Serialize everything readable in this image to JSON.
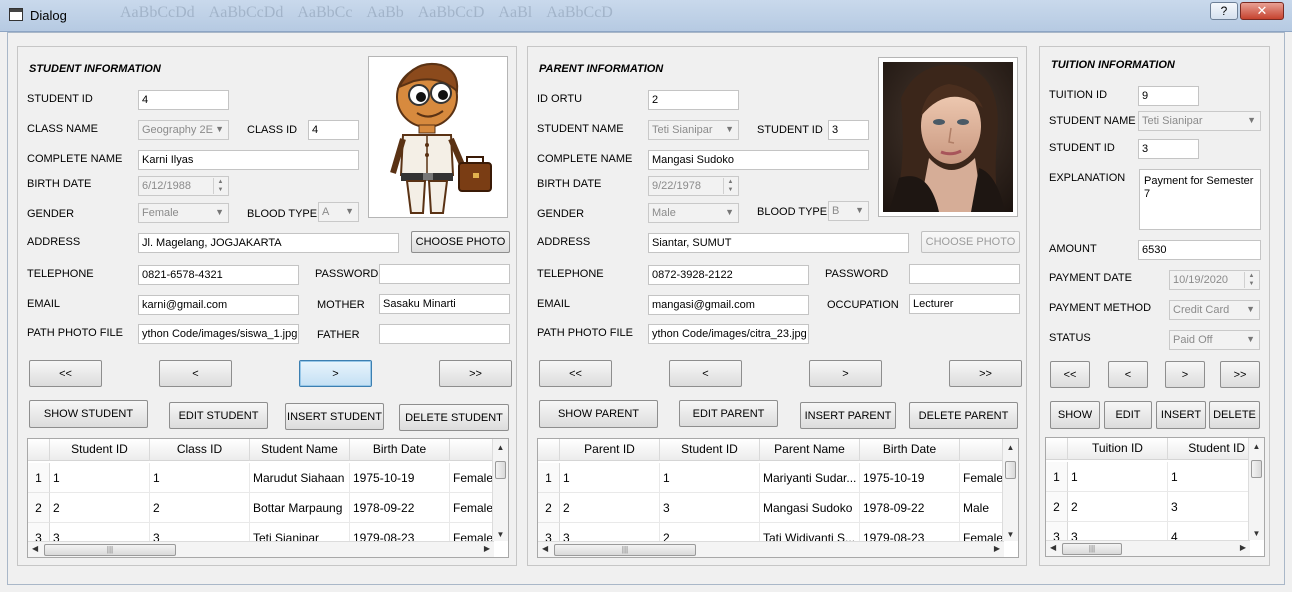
{
  "window": {
    "title": "Dialog",
    "help_glyph": "?",
    "close_glyph": "✕",
    "ribbon_ghost": [
      "AaBbCcDd",
      "AaBbCcDd",
      "AaBbCc",
      "AaBb",
      "AaBbCcD",
      "AaBl",
      "AaBbCcD"
    ]
  },
  "student": {
    "title": "STUDENT INFORMATION",
    "labels": {
      "student_id": "STUDENT ID",
      "class_name": "CLASS NAME",
      "class_id": "CLASS ID",
      "complete_name": "COMPLETE NAME",
      "birth_date": "BIRTH DATE",
      "gender": "GENDER",
      "blood_type": "BLOOD TYPE",
      "address": "ADDRESS",
      "telephone": "TELEPHONE",
      "password": "PASSWORD",
      "email": "EMAIL",
      "mother": "MOTHER",
      "path_photo": "PATH PHOTO FILE",
      "father": "FATHER"
    },
    "values": {
      "student_id": "4",
      "class_name": "Geography 2E",
      "class_id": "4",
      "complete_name": "Karni Ilyas",
      "birth_date": "6/12/1988",
      "gender": "Female",
      "blood_type": "A",
      "address": "Jl. Magelang, JOGJAKARTA",
      "telephone": "0821-6578-4321",
      "password": "",
      "email": "karni@gmail.com",
      "mother": "Sasaku Minarti",
      "path_photo": "ython Code/images/siswa_1.jpg",
      "father": ""
    },
    "buttons": {
      "choose_photo": "CHOOSE PHOTO",
      "first": "<<",
      "prev": "<",
      "next": ">",
      "last": ">>",
      "show": "SHOW STUDENT",
      "edit": "EDIT STUDENT",
      "insert": "INSERT STUDENT",
      "delete": "DELETE STUDENT"
    },
    "table": {
      "columns": [
        "Student ID",
        "Class ID",
        "Student Name",
        "Birth Date",
        "G"
      ],
      "rows": [
        {
          "n": "1",
          "c": [
            "1",
            "1",
            "Marudut Siahaan",
            "1975-10-19",
            "Female"
          ]
        },
        {
          "n": "2",
          "c": [
            "2",
            "2",
            "Bottar Marpaung",
            "1978-09-22",
            "Female"
          ]
        },
        {
          "n": "3",
          "c": [
            "3",
            "3",
            "Teti Sianipar",
            "1979-08-23",
            "Female"
          ]
        }
      ]
    }
  },
  "parent": {
    "title": "PARENT INFORMATION",
    "labels": {
      "id_ortu": "ID ORTU",
      "student_name": "STUDENT NAME",
      "student_id": "STUDENT ID",
      "complete_name": "COMPLETE NAME",
      "birth_date": "BIRTH DATE",
      "gender": "GENDER",
      "blood_type": "BLOOD TYPE",
      "address": "ADDRESS",
      "telephone": "TELEPHONE",
      "password": "PASSWORD",
      "email": "EMAIL",
      "occupation": "OCCUPATION",
      "path_photo": "PATH PHOTO FILE"
    },
    "values": {
      "id_ortu": "2",
      "student_name": "Teti Sianipar",
      "student_id": "3",
      "complete_name": "Mangasi Sudoko",
      "birth_date": "9/22/1978",
      "gender": "Male",
      "blood_type": "B",
      "address": "Siantar, SUMUT",
      "telephone": "0872-3928-2122",
      "password": "",
      "email": "mangasi@gmail.com",
      "occupation": "Lecturer",
      "path_photo": "ython Code/images/citra_23.jpg"
    },
    "buttons": {
      "choose_photo": "CHOOSE PHOTO",
      "first": "<<",
      "prev": "<",
      "next": ">",
      "last": ">>",
      "show": "SHOW PARENT",
      "edit": "EDIT PARENT",
      "insert": "INSERT PARENT",
      "delete": "DELETE PARENT"
    },
    "table": {
      "columns": [
        "Parent ID",
        "Student ID",
        "Parent Name",
        "Birth Date",
        "G"
      ],
      "rows": [
        {
          "n": "1",
          "c": [
            "1",
            "1",
            "Mariyanti Sudar...",
            "1975-10-19",
            "Female"
          ]
        },
        {
          "n": "2",
          "c": [
            "2",
            "3",
            "Mangasi Sudoko",
            "1978-09-22",
            "Male"
          ]
        },
        {
          "n": "3",
          "c": [
            "3",
            "2",
            "Tati Widivanti S...",
            "1979-08-23",
            "Female"
          ]
        }
      ]
    }
  },
  "tuition": {
    "title": "TUITION INFORMATION",
    "labels": {
      "tuition_id": "TUITION ID",
      "student_name": "STUDENT NAME",
      "student_id": "STUDENT ID",
      "explanation": "EXPLANATION",
      "amount": "AMOUNT",
      "payment_date": "PAYMENT DATE",
      "payment_method": "PAYMENT METHOD",
      "status": "STATUS"
    },
    "values": {
      "tuition_id": "9",
      "student_name": "Teti Sianipar",
      "student_id": "3",
      "explanation": "Payment for Semester 7",
      "amount": "6530",
      "payment_date": "10/19/2020",
      "payment_method": "Credit Card",
      "status": "Paid Off"
    },
    "buttons": {
      "first": "<<",
      "prev": "<",
      "next": ">",
      "last": ">>",
      "show": "SHOW",
      "edit": "EDIT",
      "insert": "INSERT",
      "delete": "DELETE"
    },
    "table": {
      "columns": [
        "Tuition ID",
        "Student ID"
      ],
      "rows": [
        {
          "n": "1",
          "c": [
            "1",
            "1"
          ]
        },
        {
          "n": "2",
          "c": [
            "2",
            "3"
          ]
        },
        {
          "n": "3",
          "c": [
            "3",
            "4"
          ]
        }
      ]
    }
  },
  "scroll": {
    "up": "▲",
    "down": "▼",
    "left": "◀",
    "right": "▶",
    "grip": "|||",
    "combo_arrow": "▼"
  }
}
